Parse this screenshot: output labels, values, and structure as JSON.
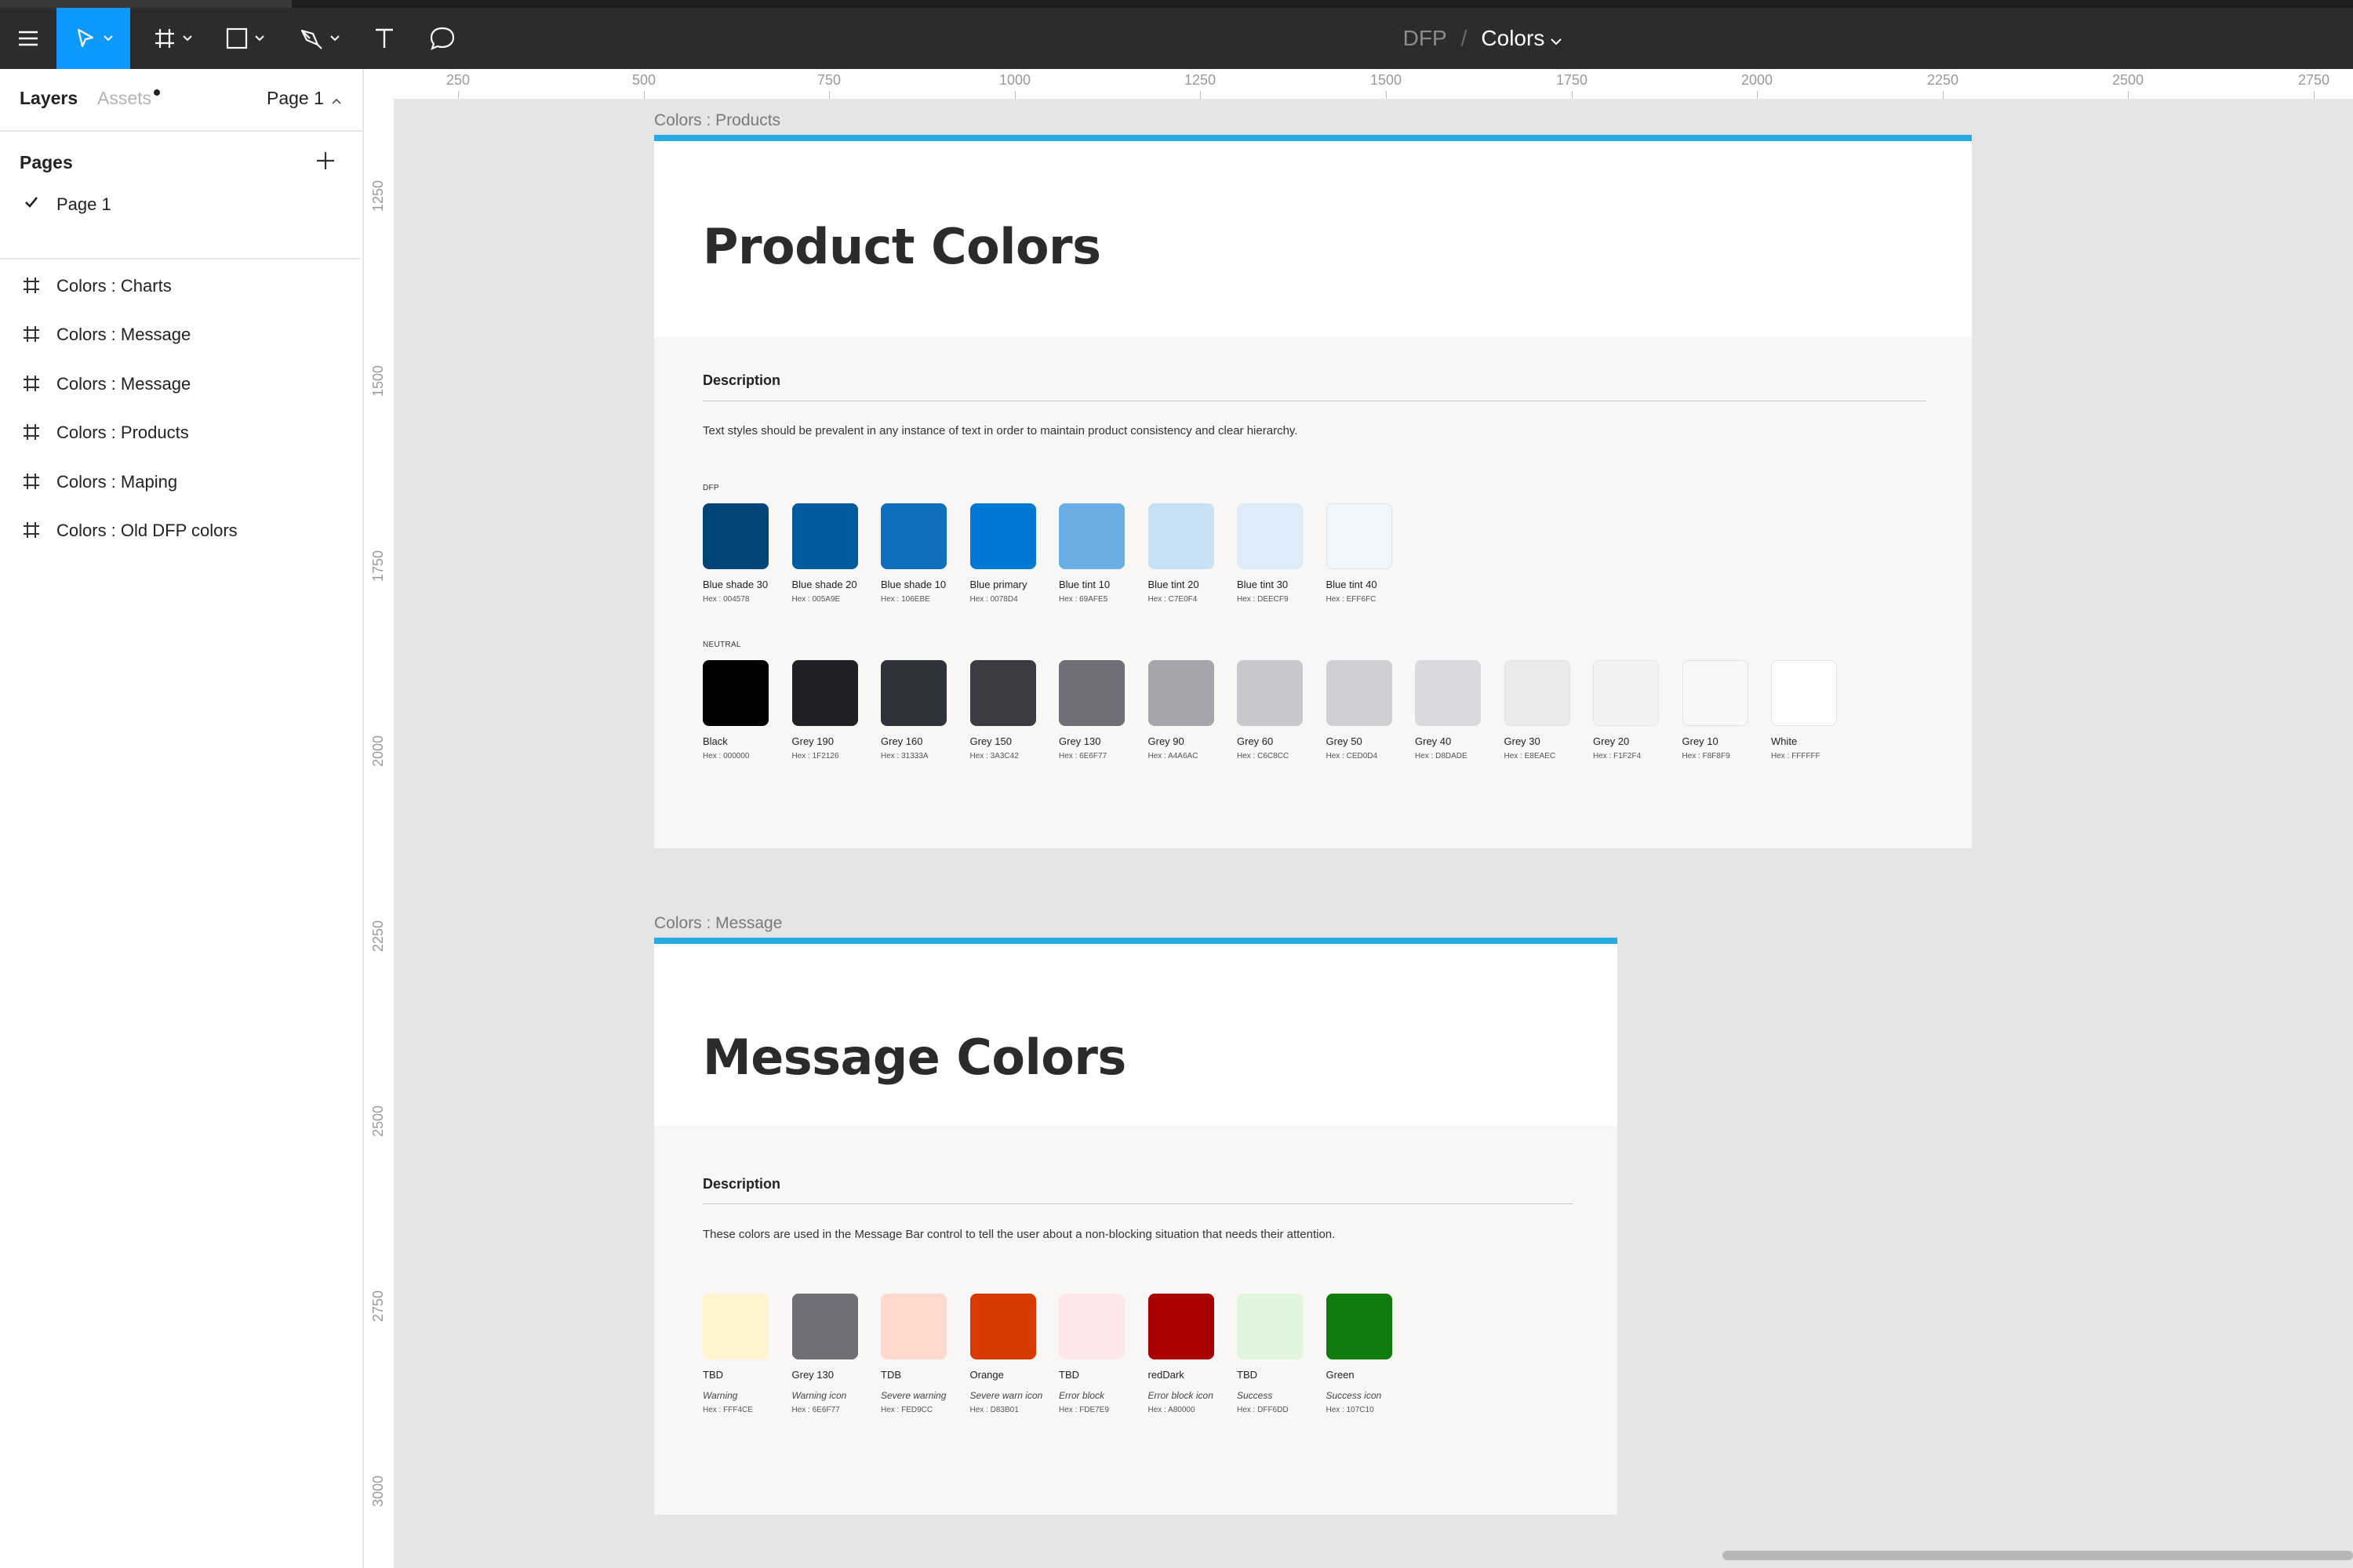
{
  "toolbar": {
    "tools": [
      "menu-icon",
      "move-icon",
      "frame-icon",
      "rectangle-icon",
      "pen-icon",
      "text-icon",
      "comment-icon"
    ],
    "accent_color": "#0d99ff"
  },
  "breadcrumb": {
    "project": "DFP",
    "separator": "/",
    "file": "Colors"
  },
  "left_panel": {
    "tab_layers": "Layers",
    "tab_assets": "Assets",
    "page_selector": "Page 1",
    "pages_header": "Pages",
    "current_page": "Page 1",
    "layers": [
      "Colors : Charts",
      "Colors : Message",
      "Colors : Message",
      "Colors : Products",
      "Colors : Maping",
      "Colors : Old DFP colors"
    ]
  },
  "rulers": {
    "top": [
      "250",
      "500",
      "750",
      "1000",
      "1250",
      "1500",
      "1750",
      "2000",
      "2250",
      "2500",
      "2750"
    ],
    "left": [
      "1250",
      "1500",
      "1750",
      "2000",
      "2250",
      "2500",
      "2750",
      "3000"
    ]
  },
  "frames": {
    "products": {
      "label": "Colors : Products",
      "title": "Product Colors",
      "description_title": "Description",
      "description": "Text styles should be prevalent in any instance of text in order to maintain product consistency and clear hierarchy.",
      "dfp_label": "DFP",
      "neutral_label": "NEUTRAL",
      "dfp": [
        {
          "name": "Blue shade 30",
          "hex": "Hex : 004578",
          "color": "#004578"
        },
        {
          "name": "Blue shade 20",
          "hex": "Hex : 005A9E",
          "color": "#005A9E"
        },
        {
          "name": "Blue shade 10",
          "hex": "Hex : 106EBE",
          "color": "#106EBE"
        },
        {
          "name": "Blue primary",
          "hex": "Hex : 0078D4",
          "color": "#0078D4"
        },
        {
          "name": "Blue tint 10",
          "hex": "Hex : 69AFE5",
          "color": "#69AFE5"
        },
        {
          "name": "Blue tint 20",
          "hex": "Hex : C7E0F4",
          "color": "#C7E0F4"
        },
        {
          "name": "Blue tint 30",
          "hex": "Hex : DEECF9",
          "color": "#DEECF9"
        },
        {
          "name": "Blue tint 40",
          "hex": "Hex : EFF6FC",
          "color": "#EFF6FC"
        }
      ],
      "neutral": [
        {
          "name": "Black",
          "hex": "Hex : 000000",
          "color": "#000000"
        },
        {
          "name": "Grey 190",
          "hex": "Hex : 1F2126",
          "color": "#1F2126"
        },
        {
          "name": "Grey 160",
          "hex": "Hex : 31333A",
          "color": "#31333A"
        },
        {
          "name": "Grey 150",
          "hex": "Hex : 3A3C42",
          "color": "#3A3C42"
        },
        {
          "name": "Grey 130",
          "hex": "Hex : 6E6F77",
          "color": "#6E6F77"
        },
        {
          "name": "Grey 90",
          "hex": "Hex : A4A6AC",
          "color": "#A4A6AC"
        },
        {
          "name": "Grey 60",
          "hex": "Hex : C6C8CC",
          "color": "#C6C8CC"
        },
        {
          "name": "Grey 50",
          "hex": "Hex : CED0D4",
          "color": "#CED0D4"
        },
        {
          "name": "Grey 40",
          "hex": "Hex : D8DADE",
          "color": "#D8DADE"
        },
        {
          "name": "Grey 30",
          "hex": "Hex : E8EAEC",
          "color": "#E8EAEC"
        },
        {
          "name": "Grey 20",
          "hex": "Hex : F1F2F4",
          "color": "#F1F2F4"
        },
        {
          "name": "Grey 10",
          "hex": "Hex : F8F8F9",
          "color": "#F8F8F9"
        },
        {
          "name": "White",
          "hex": "Hex : FFFFFF",
          "color": "#FFFFFF"
        }
      ]
    },
    "message": {
      "label": "Colors : Message",
      "title": "Message Colors",
      "description_title": "Description",
      "description": "These colors are used in the Message Bar control to tell the user about a non-blocking situation that needs their attention.",
      "swatches": [
        {
          "name": "TBD",
          "use": "Warning",
          "hex": "Hex : FFF4CE",
          "color": "#FFF4CE"
        },
        {
          "name": "Grey 130",
          "use": "Warning icon",
          "hex": "Hex : 6E6F77",
          "color": "#6E6F77"
        },
        {
          "name": "TDB",
          "use": "Severe warning",
          "hex": "Hex : FED9CC",
          "color": "#FED9CC"
        },
        {
          "name": "Orange",
          "use": "Severe warn icon",
          "hex": "Hex : D83B01",
          "color": "#D83B01"
        },
        {
          "name": "TBD",
          "use": "Error block",
          "hex": "Hex : FDE7E9",
          "color": "#FDE7E9"
        },
        {
          "name": "redDark",
          "use": "Error block icon",
          "hex": "Hex : A80000",
          "color": "#A80000"
        },
        {
          "name": "TBD",
          "use": "Success",
          "hex": "Hex : DFF6DD",
          "color": "#DFF6DD"
        },
        {
          "name": "Green",
          "use": "Success icon",
          "hex": "Hex : 107C10",
          "color": "#107C10"
        }
      ]
    }
  }
}
